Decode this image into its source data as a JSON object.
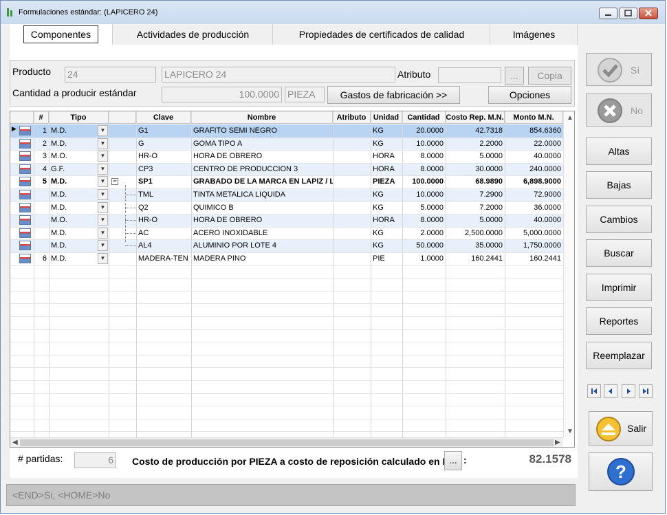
{
  "window": {
    "title": "Formulaciones estándar: (LAPICERO 24)"
  },
  "tabs": [
    {
      "label": "Componentes"
    },
    {
      "label": "Actividades de producción"
    },
    {
      "label": "Propiedades de certificados de calidad"
    },
    {
      "label": "Imágenes"
    }
  ],
  "header": {
    "producto_label": "Producto",
    "producto_code": "24",
    "producto_name": "LAPICERO 24",
    "atributo_label": "Atributo",
    "atributo_value": "",
    "ellipsis": "...",
    "copia": "Copia",
    "cantidad_label": "Cantidad a producir estándar",
    "cantidad_value": "100.0000",
    "unidad": "PIEZA",
    "gastos": "Gastos de fabricación >>",
    "opciones": "Opciones"
  },
  "grid": {
    "columns": [
      "#",
      "Tipo",
      "Clave",
      "Nombre",
      "Atributo",
      "Unidad",
      "Cantidad",
      "Costo Rep. M.N.",
      "Monto M.N."
    ],
    "rows": [
      {
        "num": "1",
        "tipo": "M.D.",
        "clave": "G1",
        "nombre": "GRAFITO SEMI NEGRO",
        "atributo": "",
        "unidad": "KG",
        "cantidad": "20.0000",
        "costo": "42.7318",
        "monto": "854.6360"
      },
      {
        "num": "2",
        "tipo": "M.D.",
        "clave": "G",
        "nombre": "GOMA TIPO A",
        "atributo": "",
        "unidad": "KG",
        "cantidad": "10.0000",
        "costo": "2.2000",
        "monto": "22.0000"
      },
      {
        "num": "3",
        "tipo": "M.O.",
        "clave": "HR-O",
        "nombre": "HORA DE OBRERO",
        "atributo": "",
        "unidad": "HORA",
        "cantidad": "8.0000",
        "costo": "5.0000",
        "monto": "40.0000"
      },
      {
        "num": "4",
        "tipo": "G.F.",
        "clave": "CP3",
        "nombre": "CENTRO DE PRODUCCION 3",
        "atributo": "",
        "unidad": "HORA",
        "cantidad": "8.0000",
        "costo": "30.0000",
        "monto": "240.0000"
      },
      {
        "num": "5",
        "tipo": "M.D.",
        "clave": "SP1",
        "nombre": "GRABADO DE LA MARCA EN LAPIZ / LAPICERO",
        "atributo": "",
        "unidad": "PIEZA",
        "cantidad": "100.0000",
        "costo": "68.9890",
        "monto": "6,898.9000"
      },
      {
        "num": "",
        "tipo": "M.D.",
        "clave": "TML",
        "nombre": "TINTA METALICA LIQUIDA",
        "atributo": "",
        "unidad": "KG",
        "cantidad": "10.0000",
        "costo": "7.2900",
        "monto": "72.9000"
      },
      {
        "num": "",
        "tipo": "M.D.",
        "clave": "Q2",
        "nombre": "QUIMICO B",
        "atributo": "",
        "unidad": "KG",
        "cantidad": "5.0000",
        "costo": "7.2000",
        "monto": "36.0000"
      },
      {
        "num": "",
        "tipo": "M.O.",
        "clave": "HR-O",
        "nombre": "HORA DE OBRERO",
        "atributo": "",
        "unidad": "HORA",
        "cantidad": "8.0000",
        "costo": "5.0000",
        "monto": "40.0000"
      },
      {
        "num": "",
        "tipo": "M.D.",
        "clave": "AC",
        "nombre": "ACERO INOXIDABLE",
        "atributo": "",
        "unidad": "KG",
        "cantidad": "2.0000",
        "costo": "2,500.0000",
        "monto": "5,000.0000"
      },
      {
        "num": "",
        "tipo": "M.D.",
        "clave": "AL4",
        "nombre": "ALUMINIO POR LOTE 4",
        "atributo": "",
        "unidad": "KG",
        "cantidad": "50.0000",
        "costo": "35.0000",
        "monto": "1,750.0000"
      },
      {
        "num": "6",
        "tipo": "M.D.",
        "clave": "MADERA-TEN",
        "nombre": "MADERA PINO",
        "atributo": "",
        "unidad": "PIE",
        "cantidad": "1.0000",
        "costo": "160.2441",
        "monto": "160.2441"
      }
    ]
  },
  "footer": {
    "partidas_label": "# partidas:",
    "partidas_value": "6",
    "costo_label": "Costo de producción por PIEZA a costo de reposición calculado en M.N.",
    "costo_btn": "...",
    "colon": ":",
    "costo_total": "82.1578",
    "status": "<END>Si, <HOME>No"
  },
  "side": {
    "si": "Sí",
    "no": "No",
    "altas": "Altas",
    "bajas": "Bajas",
    "cambios": "Cambios",
    "buscar": "Buscar",
    "imprimir": "Imprimir",
    "reportes": "Reportes",
    "reemplazar": "Reemplazar",
    "salir": "Salir"
  },
  "colors": {
    "selected_row": "#b9d4f3",
    "alt_row": "#e8f1fb",
    "accent": "#2f6fd0"
  }
}
